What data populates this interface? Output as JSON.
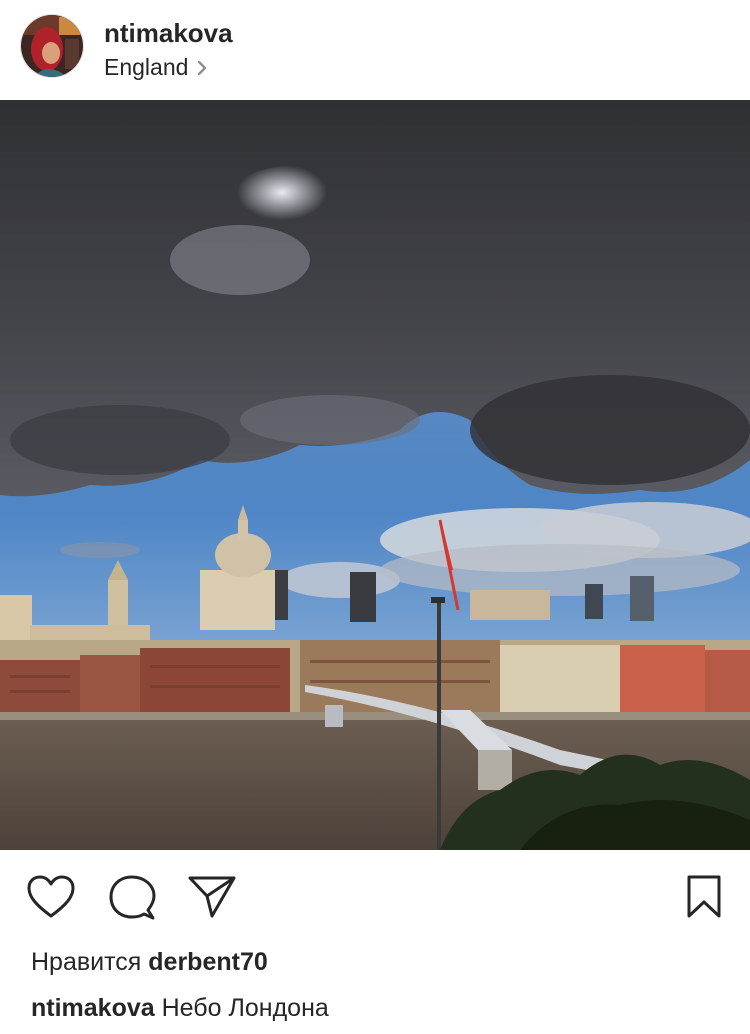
{
  "post": {
    "username": "ntimakova",
    "location": "England",
    "likes_prefix": "Нравится",
    "liked_by": "derbent70",
    "caption_user": "ntimakova",
    "caption_text": "Небо Лондона"
  },
  "icons": {
    "avatar": "avatar-photo",
    "location_chevron": "chevron-right-icon",
    "like": "heart-icon",
    "comment": "comment-bubble-icon",
    "share": "paper-plane-icon",
    "save": "bookmark-icon"
  },
  "colors": {
    "text": "#262626",
    "background": "#ffffff",
    "sky": "#4f86c6",
    "cloud_dark": "#3a3a40",
    "river": "#5d5045"
  }
}
